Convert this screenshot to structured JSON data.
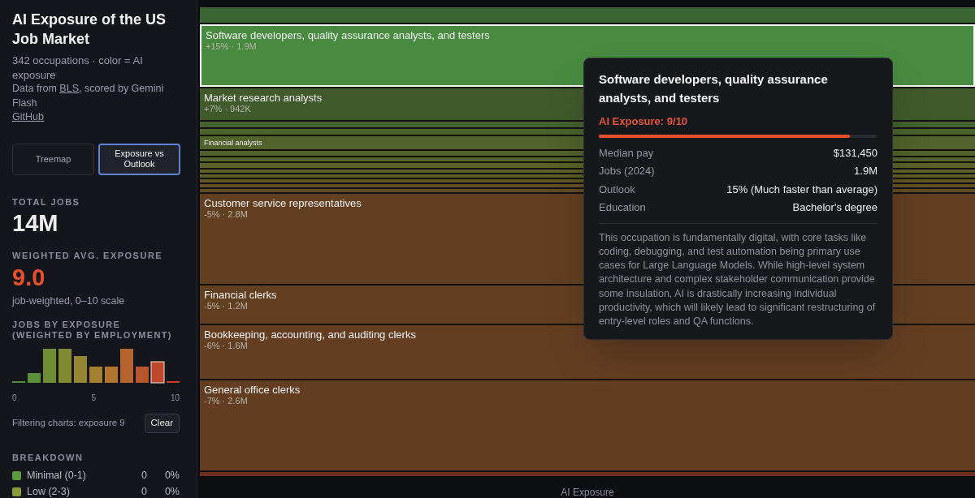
{
  "sidebar": {
    "title": "AI Exposure of the US Job Market",
    "subtitle": "342 occupations · color = AI exposure",
    "source_prefix": "Data from ",
    "source_link": "BLS",
    "source_suffix": ", scored by Gemini Flash",
    "github_link": "GitHub",
    "view_tabs": [
      {
        "label": "Treemap",
        "selected": false
      },
      {
        "label": "Exposure vs Outlook",
        "selected": true
      }
    ],
    "total_jobs": {
      "label": "TOTAL JOBS",
      "value": "14M"
    },
    "avg_exposure": {
      "label": "WEIGHTED AVG. EXPOSURE",
      "value": "9.0",
      "note": "job-weighted, 0–10 scale"
    },
    "histogram": {
      "label": "JOBS BY EXPOSURE (WEIGHTED BY EMPLOYMENT)",
      "ticks": [
        "0",
        "5",
        "10"
      ]
    },
    "filter": {
      "text": "Filtering charts: exposure 9",
      "clear": "Clear"
    },
    "breakdown": {
      "label": "BREAKDOWN",
      "rows": [
        {
          "name": "Minimal (0-1)",
          "count": "0",
          "share": "0%",
          "color": "#5a9a3e"
        },
        {
          "name": "Low (2-3)",
          "count": "0",
          "share": "0%",
          "color": "#8a9a3a"
        }
      ]
    }
  },
  "treemap": {
    "axis_label": "AI Exposure",
    "tiles": [
      {
        "kind": "strip",
        "color": "#3a6532",
        "selected": false
      },
      {
        "kind": "tile",
        "name": "Software developers, quality assurance analysts, and testers",
        "detail": "+15% · 1.9M",
        "color": "#488a40",
        "selected": true
      },
      {
        "kind": "tile",
        "name": "Market research analysts",
        "detail": "+7% · 942K",
        "color": "#405a2b",
        "selected": false
      },
      {
        "kind": "strip",
        "color": "#44602c",
        "selected": false
      },
      {
        "kind": "strip",
        "color": "#4a622c",
        "selected": false
      },
      {
        "kind": "small",
        "name": "Financial analysts",
        "color": "#4f632b",
        "selected": false
      },
      {
        "kind": "strip",
        "color": "#52622a",
        "selected": false
      },
      {
        "kind": "strip",
        "color": "#56622a",
        "selected": false
      },
      {
        "kind": "strip",
        "color": "#5a6229",
        "selected": false
      },
      {
        "kind": "strip",
        "color": "#5d6028",
        "selected": false
      },
      {
        "kind": "strip",
        "color": "#605c27",
        "selected": false
      },
      {
        "kind": "strip",
        "color": "#625626",
        "selected": false
      },
      {
        "kind": "strip",
        "color": "#635025",
        "selected": false
      },
      {
        "kind": "strip",
        "color": "#634a24",
        "selected": false
      },
      {
        "kind": "tile",
        "name": "Customer service representatives",
        "detail": "-5% · 2.8M",
        "color": "#633f22",
        "selected": false
      },
      {
        "kind": "tile",
        "name": "Financial clerks",
        "detail": "-5% · 1.2M",
        "color": "#633f22",
        "selected": false
      },
      {
        "kind": "tile",
        "name": "Bookkeeping, accounting, and auditing clerks",
        "detail": "-6% · 1.6M",
        "color": "#633e22",
        "selected": false
      },
      {
        "kind": "tile",
        "name": "General office clerks",
        "detail": "-7% · 2.6M",
        "color": "#633d22",
        "selected": false
      },
      {
        "kind": "strip",
        "color": "#6b3022",
        "selected": false
      }
    ]
  },
  "tooltip": {
    "title": "Software developers, quality assurance analysts, and testers",
    "exposure": "AI Exposure: 9/10",
    "level": 0.9,
    "facts": [
      {
        "label": "Median pay",
        "value": "$131,450"
      },
      {
        "label": "Jobs (2024)",
        "value": "1.9M"
      },
      {
        "label": "Outlook",
        "value": "15% (Much faster than average)"
      },
      {
        "label": "Education",
        "value": "Bachelor's degree"
      }
    ],
    "description": "This occupation is fundamentally digital, with core tasks like coding, debugging, and test automation being primary use cases for Large Language Models. While high-level system architecture and complex stakeholder communication provide some insulation, AI is drastically increasing individual productivity, which will likely lead to significant restructuring of entry-level roles and QA functions."
  }
}
